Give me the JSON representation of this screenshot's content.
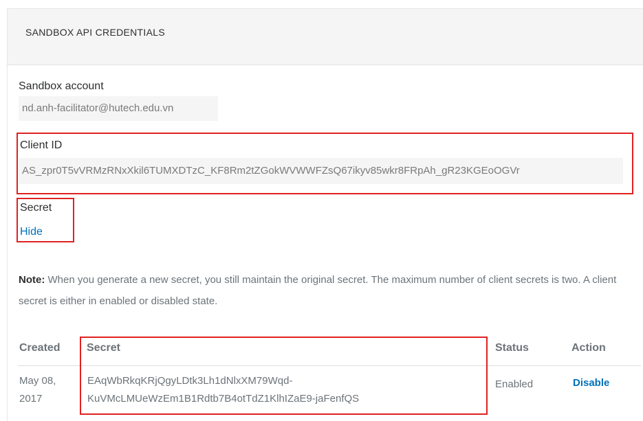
{
  "panel": {
    "title": "SANDBOX API CREDENTIALS"
  },
  "sandbox_account": {
    "label": "Sandbox account",
    "value": "nd.anh-facilitator@hutech.edu.vn"
  },
  "client_id": {
    "label": "Client ID",
    "value": "AS_zpr0T5vVRMzRNxXkil6TUMXDTzC_KF8Rm2tZGokWVWWFZsQ67ikyv85wkr8FRpAh_gR23KGEoOGVr"
  },
  "secret": {
    "label": "Secret",
    "hide_link": "Hide"
  },
  "note": {
    "bold": "Note:",
    "text": " When you generate a new secret, you still maintain the original secret. The maximum number of client secrets is two. A client secret is either in enabled or disabled state."
  },
  "secrets_table": {
    "headers": {
      "created": "Created",
      "secret": "Secret",
      "status": "Status",
      "action": "Action"
    },
    "rows": [
      {
        "created_line1": "May 08,",
        "created_line2": "2017",
        "secret_line1": "EAqWbRkqKRjQgyLDtk3Lh1dNlxXM79Wqd-",
        "secret_line2": "KuVMcLMUeWzEm1B1Rdtb7B4otTdZ1KlhIZaE9-jaFenfQS",
        "status": "Enabled",
        "action": "Disable"
      }
    ]
  },
  "colors": {
    "link": "#0070ba",
    "highlight_box": "#e02020",
    "header_bg": "#f5f5f5"
  }
}
